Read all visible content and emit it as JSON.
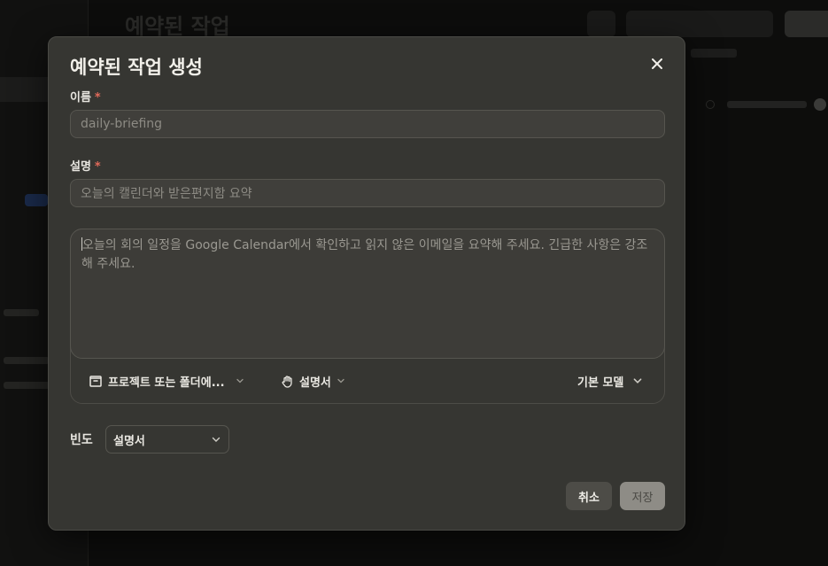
{
  "background": {
    "page_title": "예약된 작업"
  },
  "modal": {
    "title": "예약된 작업 생성",
    "close_icon": "close-icon",
    "name_field": {
      "label": "이름",
      "required_mark": "*",
      "placeholder": "daily-briefing"
    },
    "description_field": {
      "label": "설명",
      "required_mark": "*",
      "placeholder": "오늘의 캘린더와 받은편지함 요약"
    },
    "prompt": {
      "placeholder": "오늘의 회의 일정을 Google Calendar에서 확인하고 읽지 않은 이메일을 요약해 주세요. 긴급한 사항은 강조해 주세요.",
      "project_selector": {
        "icon": "folder-icon",
        "label": "프로젝트 또는 폴더에..."
      },
      "instructions_selector": {
        "icon": "hand-icon",
        "label": "설명서"
      },
      "model_selector": {
        "label": "기본 모델"
      }
    },
    "frequency": {
      "label": "빈도",
      "selected": "설명서"
    },
    "actions": {
      "cancel_label": "취소",
      "save_label": "저장"
    }
  },
  "colors": {
    "required": "#e26a5a",
    "modal_bg": "#363632",
    "save_disabled": "#8e8c86"
  }
}
